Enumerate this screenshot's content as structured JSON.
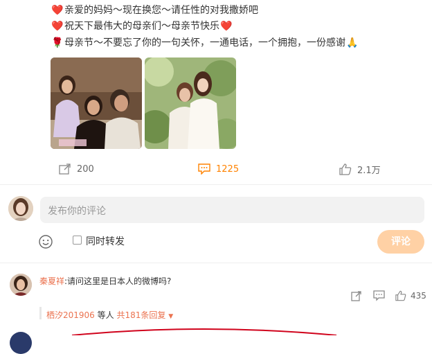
{
  "post": {
    "lines": [
      {
        "emoji": "❤️",
        "text": "亲爱的妈妈～现在换您～请任性的对我撒娇吧"
      },
      {
        "emoji": "❤️",
        "text": "祝天下最伟大的母亲们～母亲节快乐",
        "trail_emoji": "❤️"
      },
      {
        "emoji": "🌹",
        "text": "母亲节～不要忘了你的一句关怀，一通电话，一个拥抱，一份感谢",
        "trail_emoji": "🙏"
      }
    ],
    "actions": {
      "repost_count": "200",
      "comment_count": "1225",
      "like_count": "2.1万"
    }
  },
  "composer": {
    "placeholder": "发布你的评论",
    "repost_label": "同时转发",
    "submit_label": "评论"
  },
  "comments": [
    {
      "user": "秦夏祥",
      "text": ":请问这里是日本人的微博吗?",
      "like_count": "435",
      "reply_summary": {
        "user": "栖汐201906",
        "middle": " 等人 ",
        "total": "共181条回复"
      }
    }
  ],
  "colors": {
    "heart": "#e8433b",
    "comment_active": "#ff8200",
    "submit_disabled": "#ffd1a5",
    "username": "#eb7350",
    "annotation_oval": "#d0021b"
  }
}
